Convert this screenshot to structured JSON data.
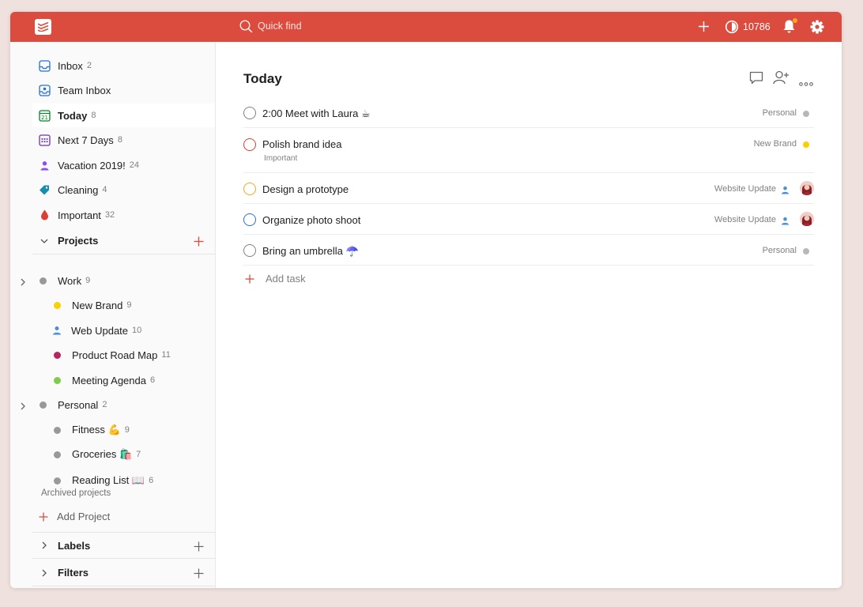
{
  "colors": {
    "brand": "#db4c3f",
    "background": "#efe1dd",
    "personal": "#b8b8b8",
    "new_brand": "#fad000",
    "web_update": "#4a90d9",
    "road_map": "#b8255f",
    "meeting": "#7ecc49",
    "vacation": "#884dff",
    "cleaning": "#158fad",
    "important": "#db4035"
  },
  "topbar": {
    "logo_icon": "todoist-logo-icon",
    "search_placeholder": "Quick find",
    "karma_value": "10786"
  },
  "sidebar": {
    "inbox": {
      "label": "Inbox",
      "count": "2"
    },
    "team_inbox": {
      "label": "Team Inbox"
    },
    "today": {
      "label": "Today",
      "count": "8"
    },
    "next7": {
      "label": "Next 7 Days",
      "count": "8"
    },
    "vacation": {
      "label": "Vacation 2019!",
      "count": "24"
    },
    "cleaning": {
      "label": "Cleaning",
      "count": "4"
    },
    "important": {
      "label": "Important",
      "count": "32"
    },
    "projects_header": "Projects",
    "projects": {
      "work": {
        "label": "Work",
        "count": "9"
      },
      "new_brand": {
        "label": "New Brand",
        "count": "9"
      },
      "web_update": {
        "label": "Web Update",
        "count": "10"
      },
      "road_map": {
        "label": "Product Road Map",
        "count": "11"
      },
      "meeting": {
        "label": "Meeting Agenda",
        "count": "6"
      },
      "personal": {
        "label": "Personal",
        "count": "2"
      },
      "fitness": {
        "label": "Fitness 💪",
        "count": "9"
      },
      "groceries": {
        "label": "Groceries 🛍️",
        "count": "7"
      },
      "reading": {
        "label": "Reading List 📖",
        "count": "6"
      }
    },
    "archived": "Archived projects",
    "add_project": "Add Project",
    "labels_header": "Labels",
    "filters_header": "Filters"
  },
  "main": {
    "title": "Today",
    "tasks": [
      {
        "content": "2:00 Meet with Laura ☕",
        "project": "Personal"
      },
      {
        "content": "Polish brand idea",
        "label": "Important",
        "project": "New Brand"
      },
      {
        "content": "Design a prototype",
        "project": "Website Update"
      },
      {
        "content": "Organize photo shoot",
        "project": "Website Update"
      },
      {
        "content": "Bring an umbrella ☂️",
        "project": "Personal"
      }
    ],
    "add_task": "Add task"
  }
}
